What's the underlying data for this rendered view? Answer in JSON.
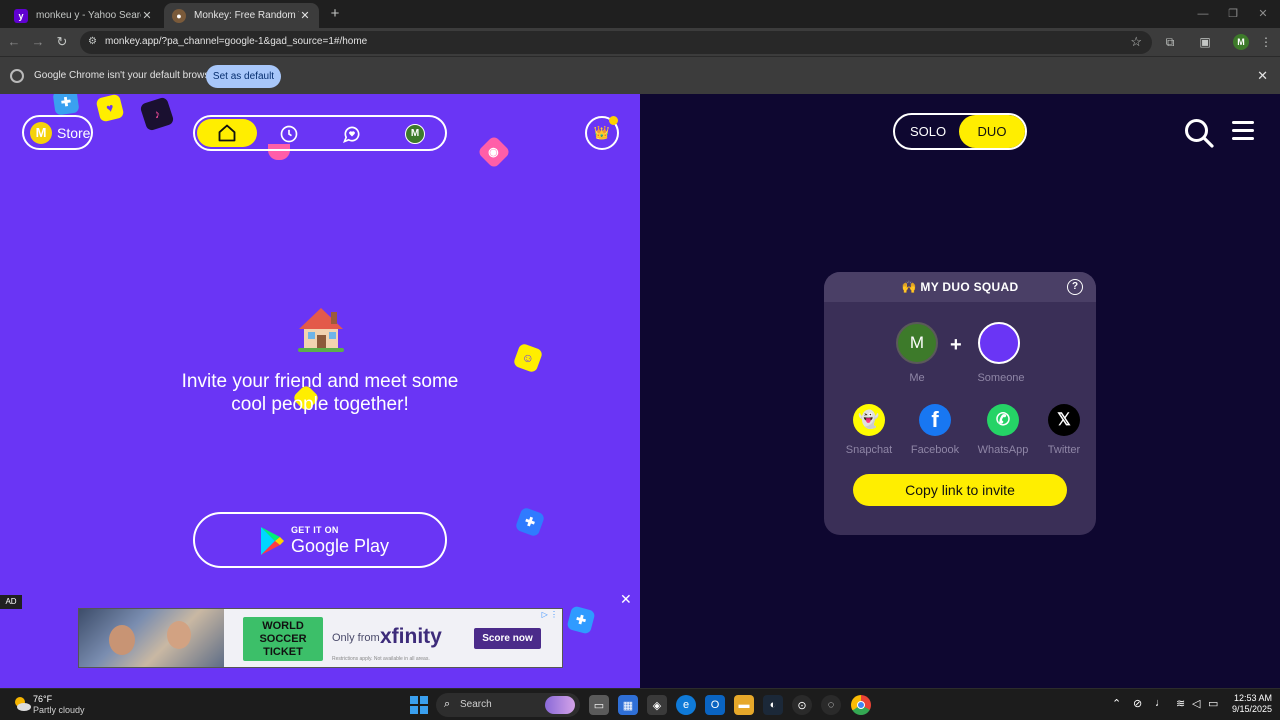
{
  "browser": {
    "tabs": [
      {
        "title": "monkeu y - Yahoo Search Resu",
        "favicon": "yahoo-y",
        "active": false
      },
      {
        "title": "Monkey: Free Random Video C",
        "favicon": "monkey",
        "active": true
      }
    ],
    "url": "monkey.app/?pa_channel=google-1&gad_source=1#/home",
    "profile_initial": "M",
    "infobar": {
      "message": "Google Chrome isn't your default browser",
      "button": "Set as default"
    }
  },
  "left_panel": {
    "store_coin": "M",
    "store_label": "Store",
    "nav": {
      "items": [
        "home-icon",
        "clock-icon",
        "chat-heart-icon",
        "profile-avatar"
      ],
      "active": "home-icon",
      "avatar_initial": "M"
    },
    "crown_icon": "crown-icon",
    "invite_text": "Invite your friend and meet some cool people together!",
    "google_play": {
      "small": "GET IT ON",
      "big": "Google Play"
    },
    "ad": {
      "tag": "AD",
      "close": "✕",
      "ticket_text": "WORLD SOCCER TICKET",
      "only_from": "Only from",
      "brand": "xfinity",
      "fine_print": "Restrictions apply. Not available in all areas.",
      "cta": "Score now",
      "adchoices": "▷ ⋮"
    }
  },
  "right_panel": {
    "mode": {
      "solo": "SOLO",
      "duo": "DUO",
      "selected": "DUO"
    },
    "squad": {
      "emoji": "🙌",
      "title": "MY DUO SQUAD",
      "help": "?",
      "me_initial": "M",
      "me_label": "Me",
      "plus": "+",
      "someone_label": "Someone",
      "share": [
        {
          "name": "Snapchat",
          "glyph": "👻",
          "color": "#fffc00"
        },
        {
          "name": "Facebook",
          "glyph": "f",
          "color": "#1877f2"
        },
        {
          "name": "WhatsApp",
          "glyph": "✆",
          "color": "#25d366"
        },
        {
          "name": "Twitter",
          "glyph": "𝕏",
          "color": "#000000"
        }
      ],
      "copy_button": "Copy link to invite"
    }
  },
  "taskbar": {
    "temperature": "76°F",
    "weather": "Partly cloudy",
    "search_placeholder": "Search",
    "time": "12:53 AM",
    "date": "9/15/2025"
  }
}
